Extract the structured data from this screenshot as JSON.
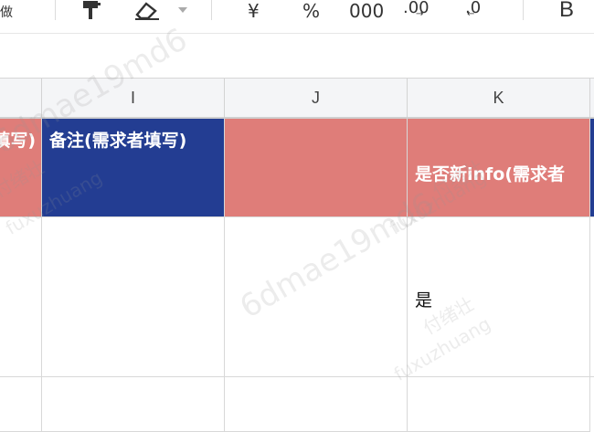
{
  "toolbar": {
    "undo_label": "做",
    "currency_label": "¥",
    "percent_label": "%",
    "thousands_label": "000",
    "decrease_decimal_label": ".00",
    "increase_decimal_label": ".0",
    "bold_label": "B"
  },
  "columns": [
    {
      "label": "I"
    },
    {
      "label": "J"
    },
    {
      "label": "K"
    }
  ],
  "header_row": {
    "h_partial": "填写)",
    "i": "备注(需求者填写)",
    "j": "",
    "k": "是否新info(需求者"
  },
  "row2": {
    "k": "是"
  },
  "watermark": {
    "code": "6dmae19md6",
    "name": "付绪壮",
    "pinyin": "fuxuzhuang"
  },
  "colors": {
    "header_pink": "#df7d79",
    "header_blue": "#233d92"
  }
}
